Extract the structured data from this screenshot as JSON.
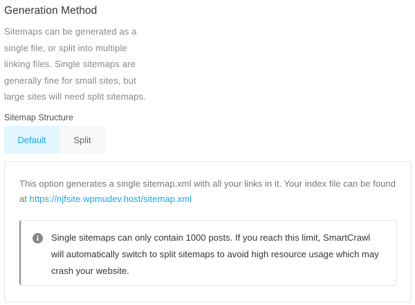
{
  "section": {
    "title": "Generation Method",
    "description": "Sitemaps can be generated as a single file, or split into multiple linking files. Single sitemaps are generally fine for small sites, but large sites will need split sitemaps."
  },
  "structure": {
    "label": "Sitemap Structure",
    "tabs": [
      {
        "label": "Default",
        "selected": true
      },
      {
        "label": "Split",
        "selected": false
      }
    ]
  },
  "default_panel": {
    "description": "This option generates a single sitemap.xml with all your links in it. Your index file can be found at",
    "sitemap_url": "https://njfsite.wpmudev.host/sitemap.xml",
    "notice": {
      "icon": "info-icon",
      "text": "Single sitemaps can only contain 1000 posts. If you reach this limit, SmartCrawl will automatically switch to split sitemaps to avoid high resource usage which may crash your website."
    }
  },
  "colors": {
    "accent": "#17a8e3",
    "selected_tab_bg": "#e1f6ff",
    "tab_bg": "#f8f8f8",
    "notice_border": "#888888"
  }
}
